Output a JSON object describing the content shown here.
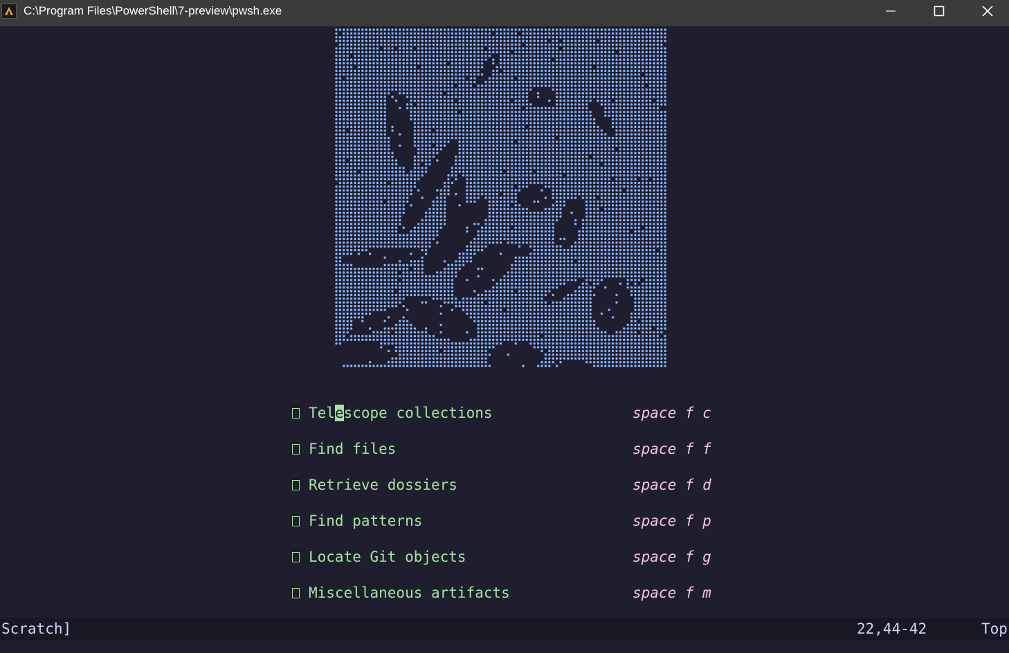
{
  "window": {
    "title": "C:\\Program Files\\PowerShell\\7-preview\\pwsh.exe",
    "icon": "powershell-preview-icon",
    "buttons": [
      "minimize-icon",
      "maximize-icon",
      "close-icon"
    ]
  },
  "colors": {
    "background": "#1e1e2e",
    "art_dots": "#89b4fa",
    "menu_label": "#a6e3a1",
    "menu_shortcut": "#f5c2e7",
    "statusline_bg": "#181825",
    "text": "#cdd6f4"
  },
  "dashboard": {
    "header_art": "braille-dot-portrait",
    "items": [
      {
        "icon": "missing-glyph-icon",
        "label_before": "Tel",
        "label_cursor": "e",
        "label_after": "scope collections",
        "shortcut": "space f c"
      },
      {
        "icon": "missing-glyph-icon",
        "label": "Find files",
        "shortcut": "space f f"
      },
      {
        "icon": "missing-glyph-icon",
        "label": "Retrieve dossiers",
        "shortcut": "space f d"
      },
      {
        "icon": "missing-glyph-icon",
        "label": "Find patterns",
        "shortcut": "space f p"
      },
      {
        "icon": "missing-glyph-icon",
        "label": "Locate Git objects",
        "shortcut": "space f g"
      },
      {
        "icon": "missing-glyph-icon",
        "label": "Miscellaneous artifacts",
        "shortcut": "space f m"
      }
    ]
  },
  "statusline": {
    "buffer_name": "Scratch]",
    "cursor_position": "22,44-42",
    "scroll_position": "Top"
  }
}
